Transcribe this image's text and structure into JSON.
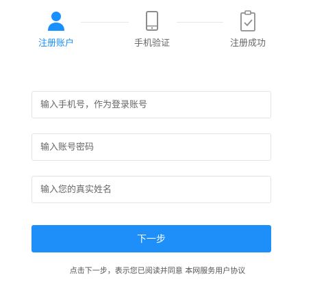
{
  "steps": [
    {
      "label": "注册账户",
      "icon": "user-icon",
      "state": "active"
    },
    {
      "label": "手机验证",
      "icon": "phone-icon",
      "state": "pending"
    },
    {
      "label": "注册成功",
      "icon": "clipboard-check-icon",
      "state": "pending"
    }
  ],
  "form": {
    "phone_placeholder": "输入手机号，作为登录账号",
    "password_placeholder": "输入账号密码",
    "name_placeholder": "输入您的真实姓名",
    "next_label": "下一步"
  },
  "agreement": {
    "prefix": "点击下一步，表示您已阅读并同意",
    "link_label": "本网服务用户协议"
  },
  "colors": {
    "accent": "#1890ff",
    "button": "#1e8ef8",
    "muted_icon": "#8c8c8c"
  }
}
